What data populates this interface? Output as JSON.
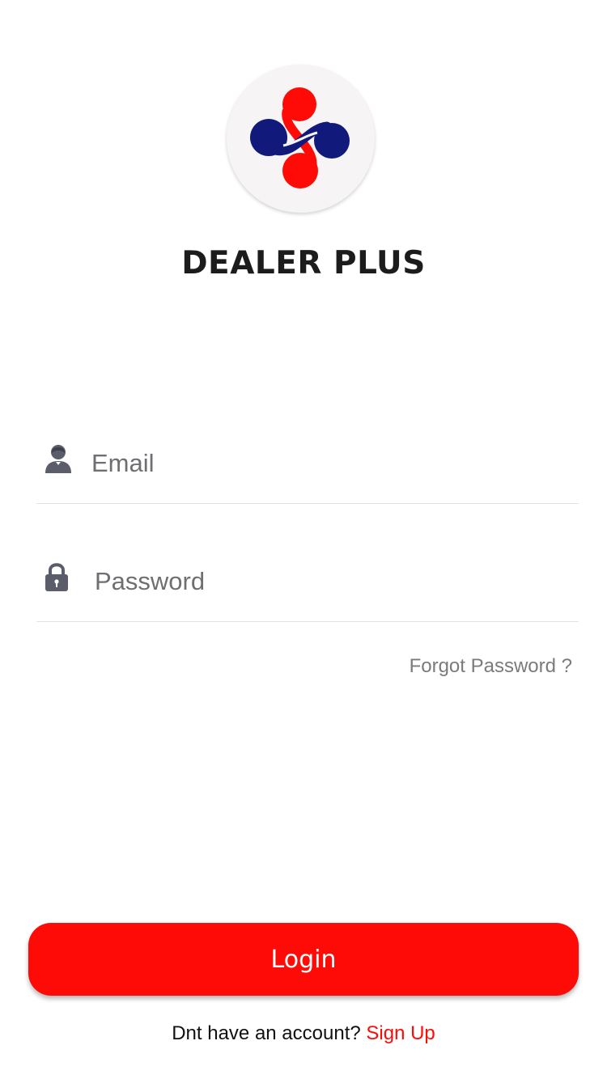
{
  "app": {
    "name": "DEALER PLUS",
    "logo_icon": "dealer-plus-logo",
    "colors": {
      "accent": "#fe0b08",
      "logo_blue": "#11197a",
      "logo_red": "#fe0b08"
    }
  },
  "form": {
    "email": {
      "placeholder": "Email",
      "value": "",
      "icon": "user-icon"
    },
    "password": {
      "placeholder": "Password",
      "value": "",
      "icon": "lock-icon"
    },
    "forgot_label": "Forgot Password ?"
  },
  "actions": {
    "login_label": "Login"
  },
  "footer": {
    "prompt": "Dnt have an account? ",
    "signup_label": "Sign Up"
  }
}
